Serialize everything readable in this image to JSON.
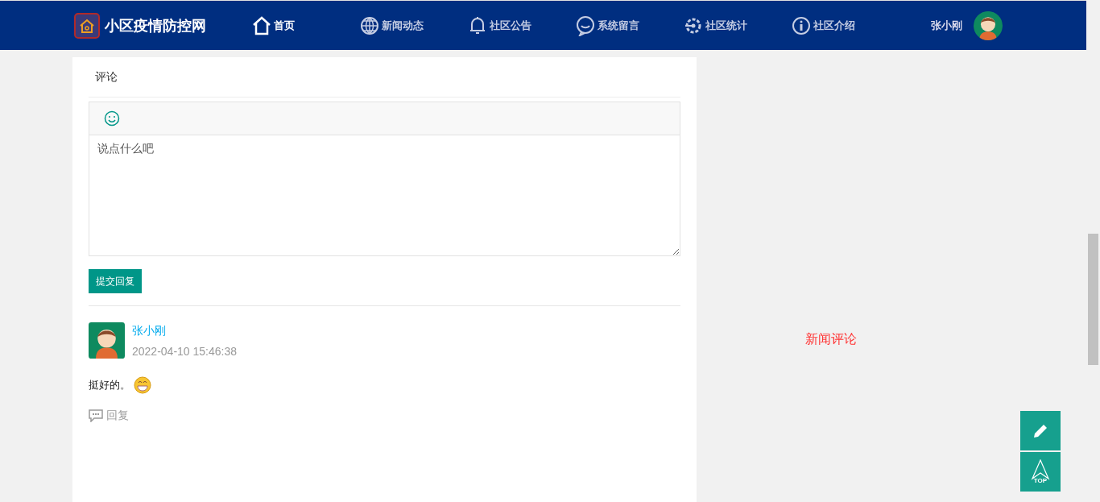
{
  "header": {
    "site_title": "小区疫情防控网",
    "nav": [
      {
        "label": "首页",
        "kind": "home",
        "selected": true
      },
      {
        "label": "新闻动态",
        "kind": "globe",
        "selected": false
      },
      {
        "label": "社区公告",
        "kind": "bell",
        "selected": false
      },
      {
        "label": "系统留言",
        "kind": "chat",
        "selected": false
      },
      {
        "label": "社区统计",
        "kind": "gear",
        "selected": false
      },
      {
        "label": "社区介绍",
        "kind": "info",
        "selected": false
      }
    ],
    "user_name": "张小刚"
  },
  "comment_panel": {
    "title": "评论",
    "editor": {
      "placeholder": "说点什么吧"
    },
    "submit_button": "提交回复",
    "comments": [
      {
        "author": "张小刚",
        "time": "2022-04-10 15:46:38",
        "text": "挺好的。",
        "reply_link": "回复"
      }
    ]
  },
  "side_label": "新闻评论",
  "float_buttons": {
    "top_label": "TOP"
  }
}
